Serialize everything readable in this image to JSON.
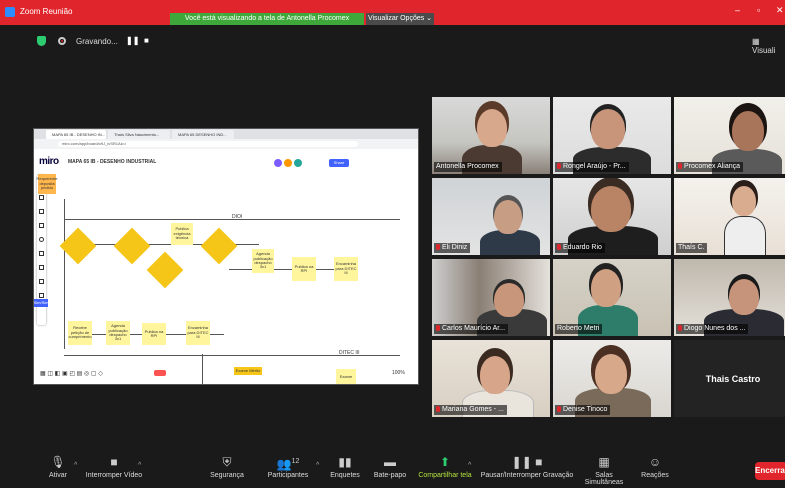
{
  "window": {
    "app_title": "Zoom Reunião",
    "share_banner": "Você está visualizando a tela de Antonella Procomex",
    "view_options": "Visualizar Opções"
  },
  "status": {
    "recording_label": "Gravando...",
    "view_label": "Visuali"
  },
  "shared_screen": {
    "tabs": [
      "MAPA 65 IB - DESENHO IN...",
      "Thaís Silva Nascimento...",
      "MAPA 65 DESENHO IND..."
    ],
    "url": "miro.com/app/board/o9J_lvSR1Ak=/",
    "board_logo": "miro",
    "board_name": "MAPA 65 IB - DESENHO INDUSTRIAL",
    "share_button": "Share",
    "flow": {
      "dioi": "DIOI",
      "ditec": "DITEC III",
      "sticky_top": "Publica exigência técnica",
      "sticky_agenda_mid": "Agenda publicação despacho 3x1",
      "sticky_publica_rpi_mid": "Publica na RPI",
      "sticky_encaminha_mid": "Encaminha para DITEC III",
      "sticky_agenda_low": "Agenda publicação despacho 3x1",
      "sticky_publica_rpi_low": "Publica na RPI",
      "sticky_encaminha_low": "Encaminha para DITEC III",
      "sticky_left_low": "Recebe petição de cumprimento",
      "sticky_bottom": "Exame",
      "sticky_top_left": "Requerente deposita pedido",
      "tag_blue": "Sim/Sim",
      "tag_yellow": "Exame Mérito"
    },
    "zoom_level": "100%"
  },
  "participants": [
    {
      "name": "Antonella Procomex",
      "muted": false,
      "active": true
    },
    {
      "name": "Rongel Araújo - Pr...",
      "muted": true,
      "active": false
    },
    {
      "name": "Procomex Aliança",
      "muted": true,
      "active": false
    },
    {
      "name": "Eli Diniz",
      "muted": true,
      "active": false
    },
    {
      "name": "Eduardo Rio",
      "muted": true,
      "active": false
    },
    {
      "name": "Thaís C.",
      "muted": false,
      "active": false
    },
    {
      "name": "Carlos Maurício Ar...",
      "muted": true,
      "active": false
    },
    {
      "name": "Roberto Metri",
      "muted": false,
      "active": false
    },
    {
      "name": "Diogo Nunes dos ...",
      "muted": true,
      "active": false
    },
    {
      "name": "Mariana Gomes - ...",
      "muted": true,
      "active": false
    },
    {
      "name": "Denise Tinoco",
      "muted": true,
      "active": false
    },
    {
      "name": "Thais Castro",
      "muted": false,
      "active": false
    }
  ],
  "toolbar": {
    "unmute": "Ativar",
    "stop_video": "Interromper Vídeo",
    "security": "Segurança",
    "participants": "Participantes",
    "participants_count": "12",
    "polls": "Enquetes",
    "chat": "Bate-papo",
    "share_screen": "Compartilhar tela",
    "pause_recording": "Pausar/Interromper Gravação",
    "breakout_rooms": "Salas Simultâneas",
    "reactions": "Reações",
    "end": "Encerrar"
  }
}
